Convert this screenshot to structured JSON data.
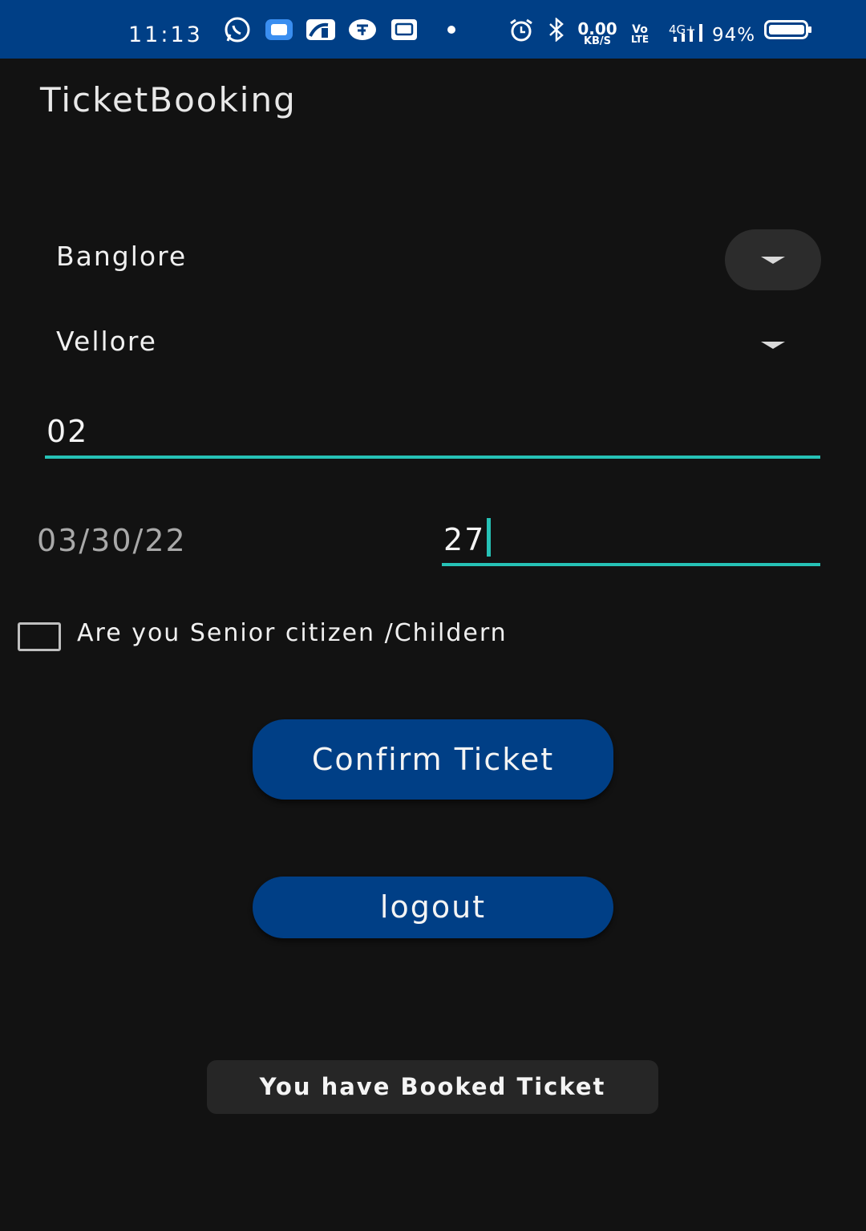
{
  "status_bar": {
    "time": "11:13",
    "net_speed_value": "0.00",
    "net_speed_unit": "KB/S",
    "volte_top": "Vo",
    "volte_bottom": "LTE",
    "network": "4G+",
    "battery": "94%",
    "icons": [
      "whatsapp-icon",
      "chat-icon",
      "app-icon",
      "paytm-icon",
      "message-icon",
      "dot-icon",
      "alarm-icon",
      "bluetooth-icon",
      "signal-icon",
      "battery-icon"
    ]
  },
  "app_bar": {
    "title": "TicketBooking"
  },
  "form": {
    "from_spinner": "Banglore",
    "to_spinner": "Vellore",
    "passengers": "02",
    "date": "03/30/22",
    "age": "27",
    "senior_checkbox_label": "Are you Senior citizen /Childern",
    "senior_checked": false
  },
  "buttons": {
    "confirm": "Confirm Ticket",
    "logout": "logout"
  },
  "toast": {
    "message": "You have Booked Ticket"
  },
  "colors": {
    "primary": "#003f86",
    "accent": "#26c2b6",
    "background": "#121212"
  }
}
